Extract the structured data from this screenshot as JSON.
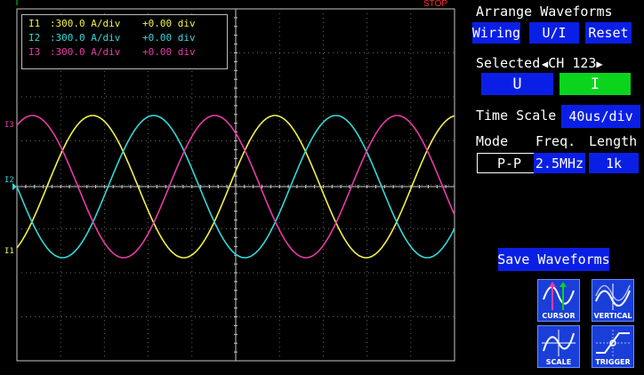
{
  "scope": {
    "status": "STOP",
    "trigger_marker": "T",
    "channels": [
      {
        "name": "I1",
        "scale": ":300.0 A/div",
        "offset": "+0.00 div",
        "color": "#f3f04a"
      },
      {
        "name": "I2",
        "scale": ":300.0 A/div",
        "offset": "+0.00 div",
        "color": "#35d7d9"
      },
      {
        "name": "I3",
        "scale": ":300.0 A/div",
        "offset": "+0.00 div",
        "color": "#e83ba6"
      }
    ],
    "left_labels": {
      "i3": "I3",
      "i2": "I2",
      "i1": "I1"
    }
  },
  "panel": {
    "arrange_title": "Arrange Waveforms",
    "wiring_label": "Wiring",
    "ui_label": "U/I",
    "reset_label": "Reset",
    "selected_label": "Selected",
    "channel_select": "CH 123",
    "u_label": "U",
    "i_label": "I",
    "time_scale_label": "Time Scale",
    "time_scale_value": "40us/div",
    "mode_label": "Mode",
    "freq_label": "Freq.",
    "length_label": "Length",
    "mode_value": "P-P",
    "freq_value": "2.5MHz",
    "length_value": "1k",
    "save_label": "Save Waveforms"
  },
  "tools": {
    "cursor": "CURSOR",
    "vertical": "VERTICAL",
    "scale": "SCALE",
    "trigger": "TRIGGER"
  },
  "colors": {
    "accent": "#0a1fe6",
    "green": "#0bd41c",
    "grid": "#c8c8c8",
    "status": "#ff2a2a"
  }
}
